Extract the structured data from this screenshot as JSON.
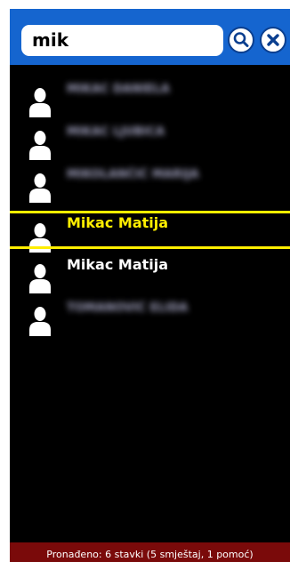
{
  "search": {
    "query": "mik"
  },
  "results": [
    {
      "name": "MIKAC DANIELA",
      "blurred": true,
      "selected": false
    },
    {
      "name": "MIKAC LJUBICA",
      "blurred": true,
      "selected": false
    },
    {
      "name": "MIKOLANČIĆ MARIJA",
      "blurred": true,
      "selected": false
    },
    {
      "name": "Mikac Matija",
      "blurred": false,
      "selected": true
    },
    {
      "name": "Mikac Matija",
      "blurred": false,
      "selected": false
    },
    {
      "name": "TOMANOVIĆ ELIDA",
      "blurred": true,
      "selected": false
    }
  ],
  "status": {
    "text": "Pronađeno: 6 stavki (5 smještaj, 1 pomoć)"
  },
  "icons": {
    "search_button": "magnifier-icon",
    "clear_button": "close-x-icon",
    "result": "user-silhouette-icon"
  },
  "colors": {
    "topbar": "#1565cf",
    "list_bg": "#000000",
    "selected": "#ffee00",
    "statusbar": "#7a0a0a"
  }
}
